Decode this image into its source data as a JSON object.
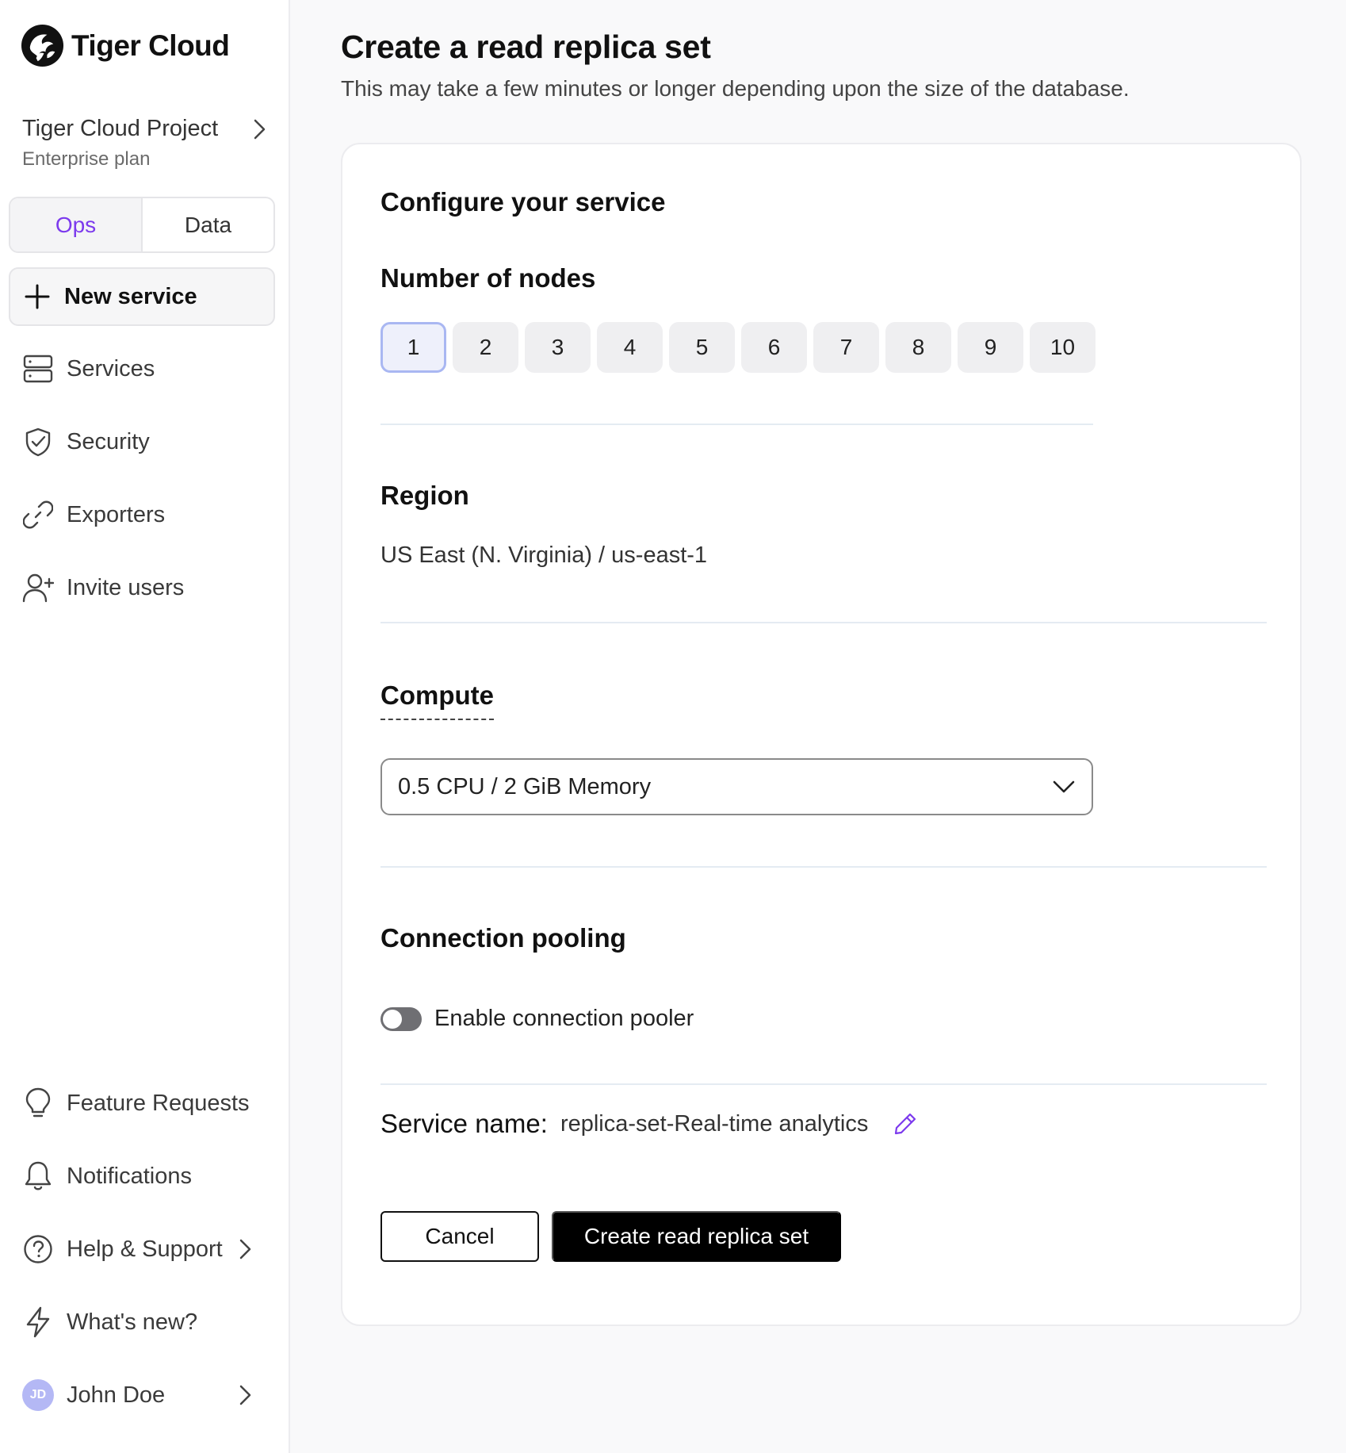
{
  "brand": {
    "name": "Tiger Cloud"
  },
  "project": {
    "name": "Tiger Cloud Project",
    "plan": "Enterprise plan"
  },
  "mode_tabs": [
    {
      "label": "Ops",
      "active": true
    },
    {
      "label": "Data",
      "active": false
    }
  ],
  "sidebar": {
    "new_service": "New service",
    "items": [
      {
        "label": "Services",
        "icon": "server-icon"
      },
      {
        "label": "Security",
        "icon": "shield-check-icon"
      },
      {
        "label": "Exporters",
        "icon": "link-icon"
      },
      {
        "label": "Invite users",
        "icon": "user-plus-icon"
      }
    ],
    "bottom_items": [
      {
        "label": "Feature Requests",
        "icon": "lightbulb-icon"
      },
      {
        "label": "Notifications",
        "icon": "bell-icon"
      },
      {
        "label": "Help & Support",
        "icon": "help-circle-icon"
      },
      {
        "label": "What's new?",
        "icon": "lightning-icon"
      }
    ],
    "user": {
      "initials": "JD",
      "name": "John Doe"
    }
  },
  "page": {
    "title": "Create a read replica set",
    "subtitle": "This may take a few minutes or longer depending upon the size of the database."
  },
  "form": {
    "heading": "Configure your service",
    "nodes": {
      "label": "Number of nodes",
      "options": [
        "1",
        "2",
        "3",
        "4",
        "5",
        "6",
        "7",
        "8",
        "9",
        "10"
      ],
      "selected": "1"
    },
    "region": {
      "label": "Region",
      "value": "US East (N. Virginia) / us-east-1"
    },
    "compute": {
      "label": "Compute",
      "value": "0.5 CPU / 2 GiB Memory"
    },
    "pooling": {
      "label": "Connection pooling",
      "toggle_label": "Enable connection pooler",
      "enabled": false
    },
    "service_name": {
      "label": "Service name:",
      "value": "replica-set-Real-time analytics"
    },
    "actions": {
      "cancel": "Cancel",
      "submit": "Create read replica set"
    }
  },
  "colors": {
    "accent": "#7c3aed",
    "selected_border": "#a9b7f2",
    "primary_button": "#000000"
  }
}
